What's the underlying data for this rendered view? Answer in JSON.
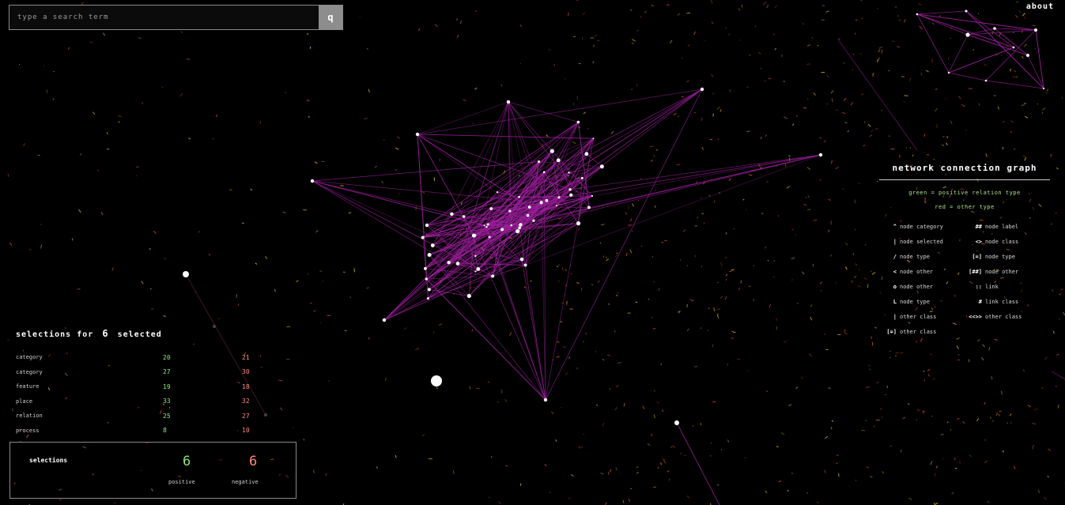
{
  "search": {
    "placeholder": "type a search term",
    "button_label": "q"
  },
  "top_link": "about",
  "legend": {
    "title": "network connection graph",
    "subtitle_1": "green = positive relation type",
    "subtitle_2": "red = other type",
    "items": [
      {
        "symbol": "^",
        "label": "node category"
      },
      {
        "symbol": "##",
        "label": "node label"
      },
      {
        "symbol": "|",
        "label": "node selected"
      },
      {
        "symbol": "<>",
        "label": "node class"
      },
      {
        "symbol": "/",
        "label": "node type"
      },
      {
        "symbol": "[=]",
        "label": "node type"
      },
      {
        "symbol": "<",
        "label": "node other"
      },
      {
        "symbol": "[##]",
        "label": "node other"
      },
      {
        "symbol": "o",
        "label": "node other"
      },
      {
        "symbol": "::",
        "label": "link"
      },
      {
        "symbol": "L",
        "label": "node type"
      },
      {
        "symbol": "#",
        "label": "link class"
      },
      {
        "symbol": "|",
        "label": "other class"
      },
      {
        "symbol": "<<>>",
        "label": "other class"
      },
      {
        "symbol": "[=]",
        "label": "other class"
      }
    ]
  },
  "stats": {
    "header_prefix": "selections",
    "header_mid": "for",
    "header_count": "6",
    "header_suffix": "selected",
    "rows": [
      {
        "label": "category",
        "green": "20",
        "red": "21"
      },
      {
        "label": "category",
        "green": "27",
        "red": "30"
      },
      {
        "label": "feature",
        "green": "19",
        "red": "18"
      },
      {
        "label": "place",
        "green": "33",
        "red": "32"
      },
      {
        "label": "relation",
        "green": "25",
        "red": "27"
      },
      {
        "label": "process",
        "green": "8",
        "red": "10"
      }
    ]
  },
  "summary": {
    "label": "selections",
    "green_value": "6",
    "red_value": "6",
    "green_caption": "positive",
    "red_caption": "negative"
  },
  "colors": {
    "edge": "#a020a0",
    "node": "#ffffff",
    "dust_1": "#e8c020",
    "dust_2": "#e05020",
    "positive": "#8ee67a",
    "negative": "#ff8a80"
  }
}
